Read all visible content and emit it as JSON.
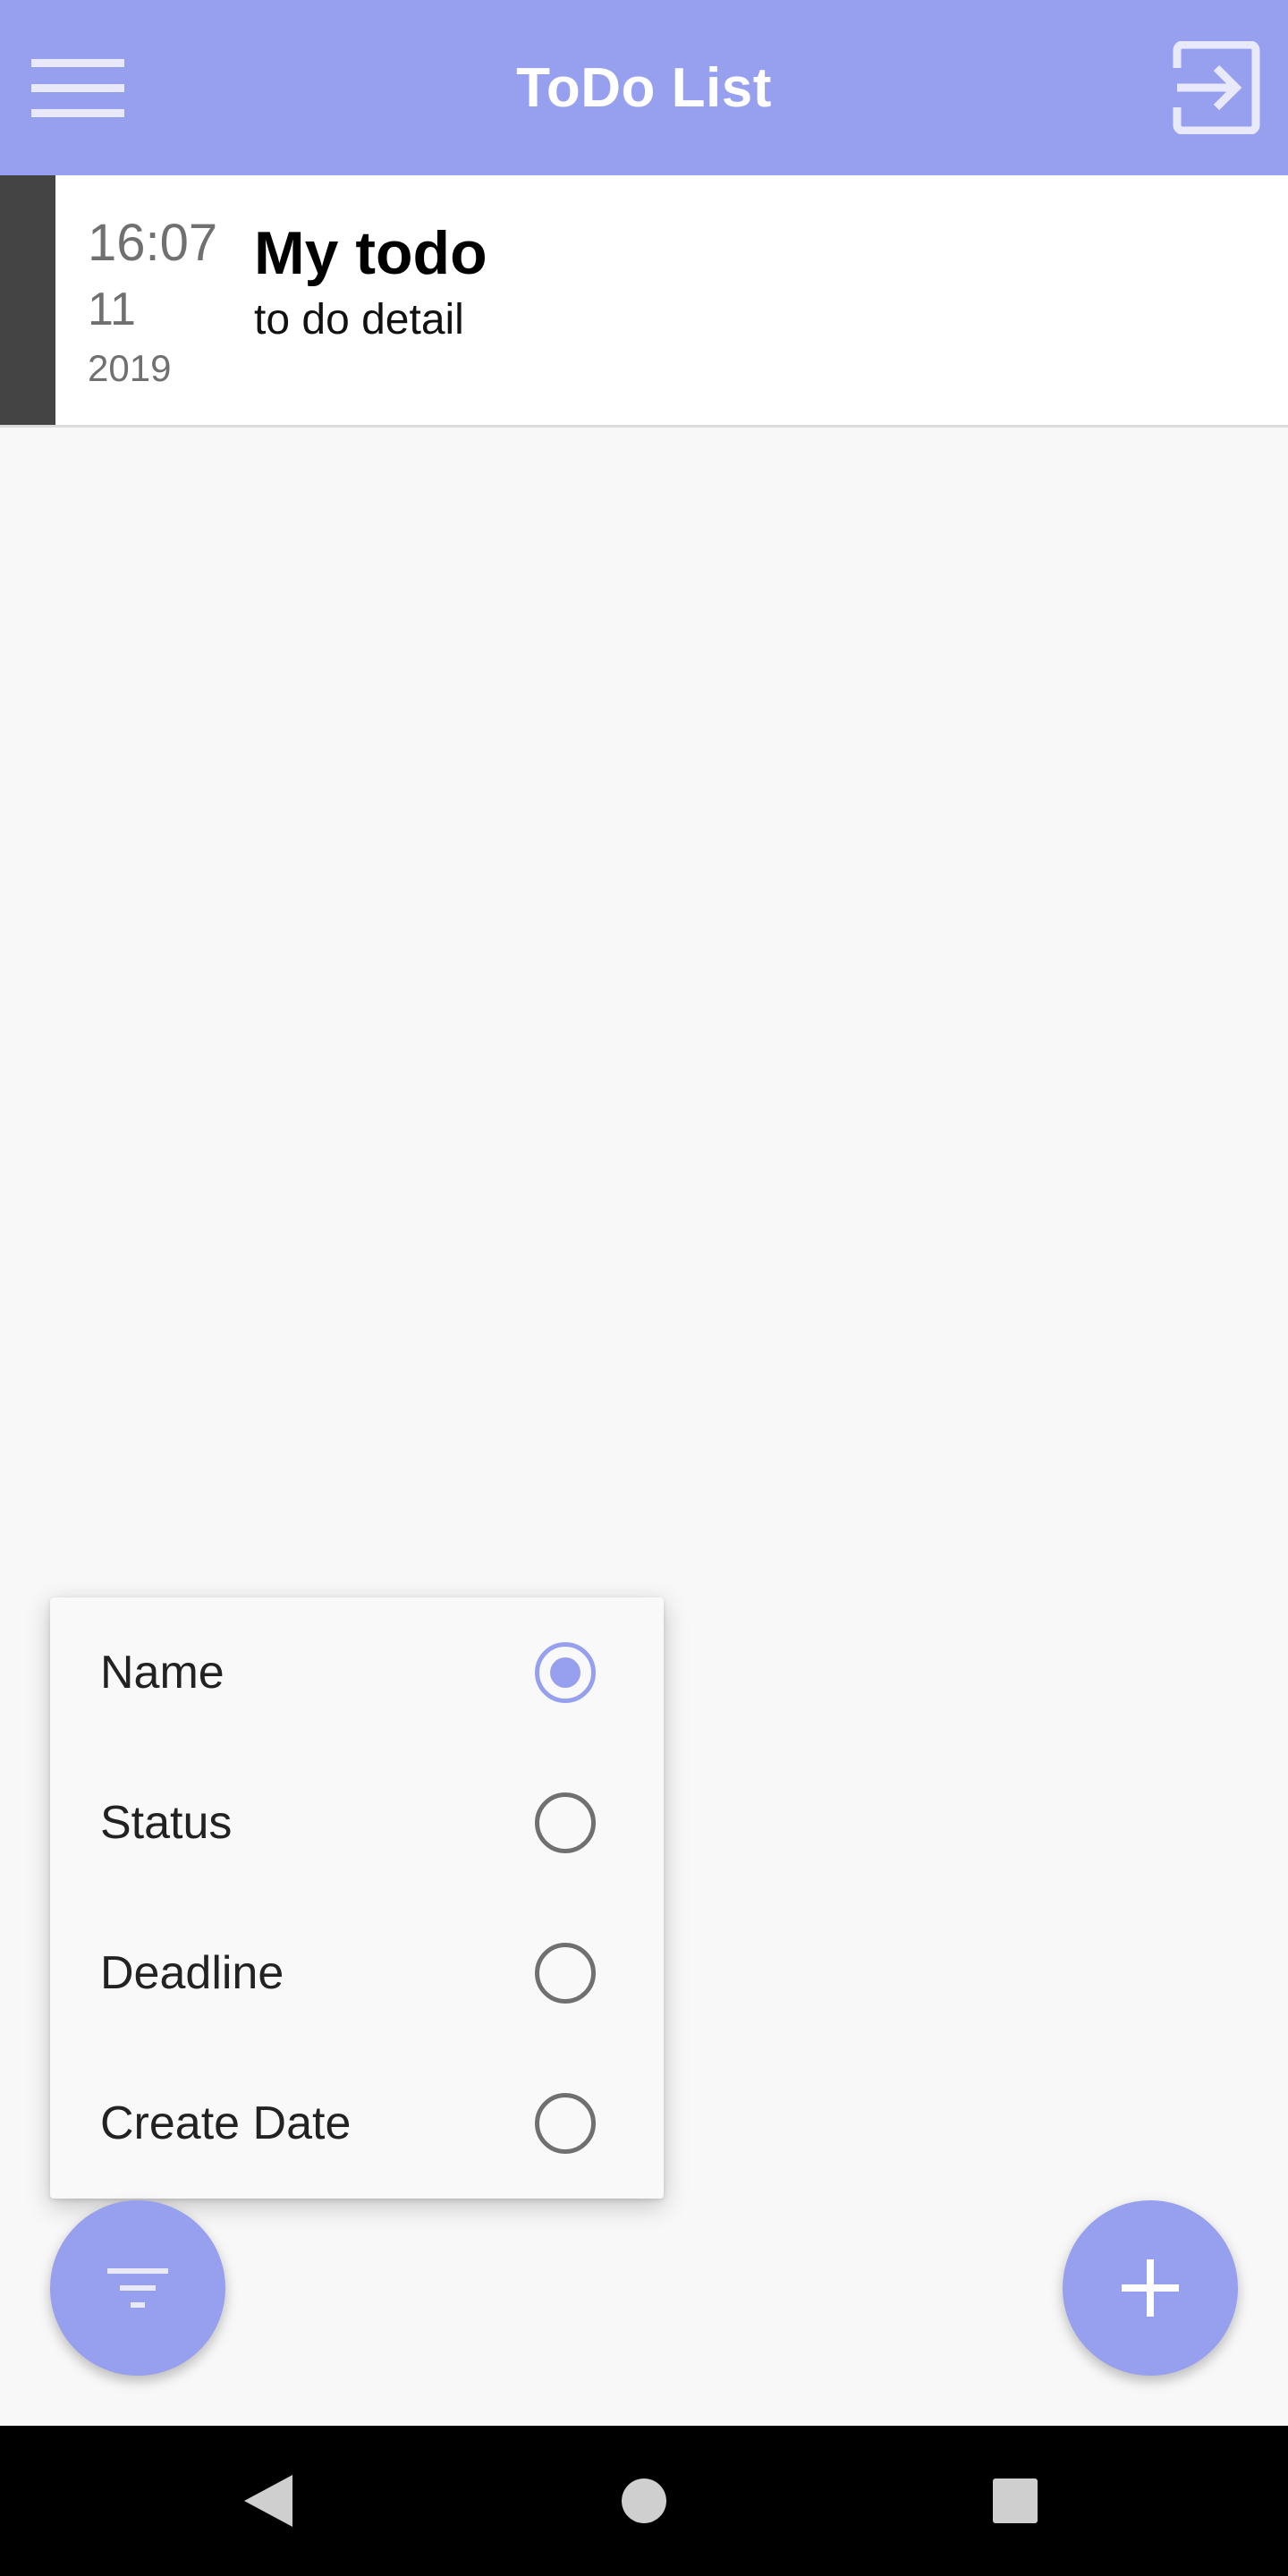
{
  "app_bar": {
    "title": "ToDo List",
    "menu_icon": "hamburger-menu-icon",
    "logout_icon": "exit-to-app-icon",
    "color": "#979fef"
  },
  "todos": [
    {
      "time": "16:07",
      "day": "11",
      "year": "2019",
      "name": "My todo",
      "detail": "to do detail",
      "accent_color": "#444444"
    }
  ],
  "sort_menu": {
    "options": [
      {
        "label": "Name",
        "selected": true
      },
      {
        "label": "Status",
        "selected": false
      },
      {
        "label": "Deadline",
        "selected": false
      },
      {
        "label": "Create Date",
        "selected": false
      }
    ]
  },
  "fabs": {
    "filter_icon": "filter-list-icon",
    "add_icon": "plus-icon"
  },
  "system_nav": {
    "back_icon": "back-triangle-icon",
    "home_icon": "home-circle-icon",
    "recents_icon": "recents-square-icon"
  }
}
